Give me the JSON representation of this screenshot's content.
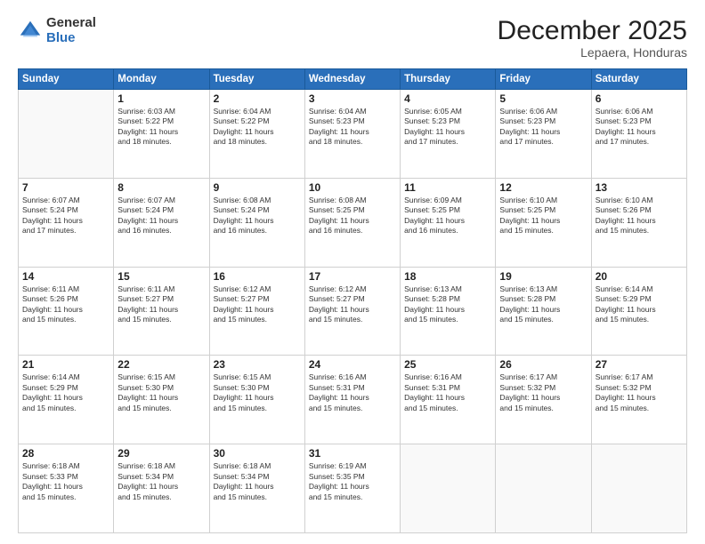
{
  "logo": {
    "general": "General",
    "blue": "Blue"
  },
  "header": {
    "month": "December 2025",
    "location": "Lepaera, Honduras"
  },
  "weekdays": [
    "Sunday",
    "Monday",
    "Tuesday",
    "Wednesday",
    "Thursday",
    "Friday",
    "Saturday"
  ],
  "weeks": [
    [
      {
        "day": "",
        "info": ""
      },
      {
        "day": "1",
        "info": "Sunrise: 6:03 AM\nSunset: 5:22 PM\nDaylight: 11 hours and 18 minutes."
      },
      {
        "day": "2",
        "info": "Sunrise: 6:04 AM\nSunset: 5:22 PM\nDaylight: 11 hours and 18 minutes."
      },
      {
        "day": "3",
        "info": "Sunrise: 6:04 AM\nSunset: 5:23 PM\nDaylight: 11 hours and 18 minutes."
      },
      {
        "day": "4",
        "info": "Sunrise: 6:05 AM\nSunset: 5:23 PM\nDaylight: 11 hours and 17 minutes."
      },
      {
        "day": "5",
        "info": "Sunrise: 6:06 AM\nSunset: 5:23 PM\nDaylight: 11 hours and 17 minutes."
      },
      {
        "day": "6",
        "info": "Sunrise: 6:06 AM\nSunset: 5:23 PM\nDaylight: 11 hours and 17 minutes."
      }
    ],
    [
      {
        "day": "7",
        "info": "Daylight: 11 hours and 17 minutes."
      },
      {
        "day": "8",
        "info": "Sunrise: 6:07 AM\nSunset: 5:24 PM\nDaylight: 11 hours and 16 minutes."
      },
      {
        "day": "9",
        "info": "Sunrise: 6:08 AM\nSunset: 5:24 PM\nDaylight: 11 hours and 16 minutes."
      },
      {
        "day": "10",
        "info": "Sunrise: 6:08 AM\nSunset: 5:25 PM\nDaylight: 11 hours and 16 minutes."
      },
      {
        "day": "11",
        "info": "Sunrise: 6:09 AM\nSunset: 5:25 PM\nDaylight: 11 hours and 16 minutes."
      },
      {
        "day": "12",
        "info": "Sunrise: 6:10 AM\nSunset: 5:25 PM\nDaylight: 11 hours and 15 minutes."
      },
      {
        "day": "13",
        "info": "Sunrise: 6:10 AM\nSunset: 5:26 PM\nDaylight: 11 hours and 15 minutes."
      }
    ],
    [
      {
        "day": "14",
        "info": "Daylight: 11 hours and 15 minutes."
      },
      {
        "day": "15",
        "info": "Sunrise: 6:11 AM\nSunset: 5:27 PM\nDaylight: 11 hours and 15 minutes."
      },
      {
        "day": "16",
        "info": "Sunrise: 6:12 AM\nSunset: 5:27 PM\nDaylight: 11 hours and 15 minutes."
      },
      {
        "day": "17",
        "info": "Sunrise: 6:12 AM\nSunset: 5:27 PM\nDaylight: 11 hours and 15 minutes."
      },
      {
        "day": "18",
        "info": "Sunrise: 6:13 AM\nSunset: 5:28 PM\nDaylight: 11 hours and 15 minutes."
      },
      {
        "day": "19",
        "info": "Sunrise: 6:13 AM\nSunset: 5:28 PM\nDaylight: 11 hours and 15 minutes."
      },
      {
        "day": "20",
        "info": "Sunrise: 6:14 AM\nSunset: 5:29 PM\nDaylight: 11 hours and 15 minutes."
      }
    ],
    [
      {
        "day": "21",
        "info": "Daylight: 11 hours and 15 minutes."
      },
      {
        "day": "22",
        "info": "Sunrise: 6:15 AM\nSunset: 5:30 PM\nDaylight: 11 hours and 15 minutes."
      },
      {
        "day": "23",
        "info": "Sunrise: 6:15 AM\nSunset: 5:30 PM\nDaylight: 11 hours and 15 minutes."
      },
      {
        "day": "24",
        "info": "Sunrise: 6:16 AM\nSunset: 5:31 PM\nDaylight: 11 hours and 15 minutes."
      },
      {
        "day": "25",
        "info": "Sunrise: 6:16 AM\nSunset: 5:31 PM\nDaylight: 11 hours and 15 minutes."
      },
      {
        "day": "26",
        "info": "Sunrise: 6:17 AM\nSunset: 5:32 PM\nDaylight: 11 hours and 15 minutes."
      },
      {
        "day": "27",
        "info": "Sunrise: 6:17 AM\nSunset: 5:32 PM\nDaylight: 11 hours and 15 minutes."
      }
    ],
    [
      {
        "day": "28",
        "info": "Sunrise: 6:18 AM\nSunset: 5:33 PM\nDaylight: 11 hours and 15 minutes."
      },
      {
        "day": "29",
        "info": "Sunrise: 6:18 AM\nSunset: 5:34 PM\nDaylight: 11 hours and 15 minutes."
      },
      {
        "day": "30",
        "info": "Sunrise: 6:18 AM\nSunset: 5:34 PM\nDaylight: 11 hours and 15 minutes."
      },
      {
        "day": "31",
        "info": "Sunrise: 6:19 AM\nSunset: 5:35 PM\nDaylight: 11 hours and 15 minutes."
      },
      {
        "day": "",
        "info": ""
      },
      {
        "day": "",
        "info": ""
      },
      {
        "day": "",
        "info": ""
      }
    ]
  ],
  "week1_full": [
    {
      "day": "7",
      "sunrise": "Sunrise: 6:07 AM",
      "sunset": "Sunset: 5:24 PM",
      "daylight": "Daylight: 11 hours and 17 minutes."
    },
    {
      "day": "14",
      "sunrise": "Sunrise: 6:11 AM",
      "sunset": "Sunset: 5:26 PM",
      "daylight": "Daylight: 11 hours and 15 minutes."
    },
    {
      "day": "21",
      "sunrise": "Sunrise: 6:14 AM",
      "sunset": "Sunset: 5:29 PM",
      "daylight": "Daylight: 11 hours and 15 minutes."
    }
  ]
}
